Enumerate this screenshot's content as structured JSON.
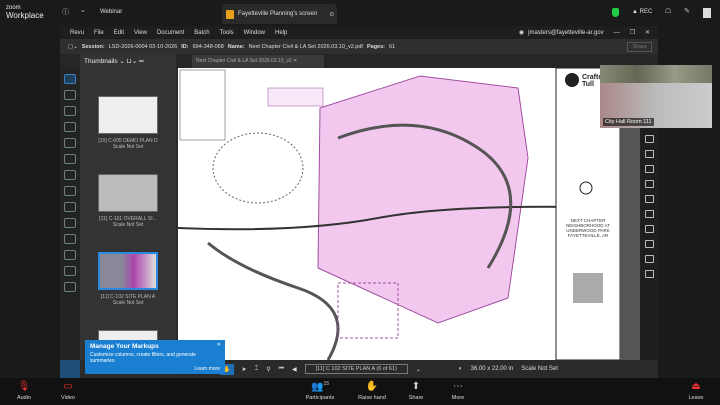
{
  "zoom": {
    "logo_top": "zoom",
    "logo_bottom": "Workplace",
    "webinar": "Webinar",
    "share_tab": "Fayetteville Planning's screen",
    "rec": "REC"
  },
  "bluebeam": {
    "menu": [
      "Revu",
      "File",
      "Edit",
      "View",
      "Document",
      "Batch",
      "Tools",
      "Window",
      "Help"
    ],
    "user": "jmasters@fayetteville-ar.gov",
    "session_label": "Session:",
    "session": "LSD-2026-0004 03-10-2026",
    "id_label": "ID:",
    "id": "694-348-068",
    "name_label": "Name:",
    "name": "Next Chapter Civil & LA Set 2026.03.10_v2.pdf",
    "pages_label": "Pages:",
    "pages": "61",
    "share": "Share",
    "panel_title": "Thumbnails",
    "doc_tab": "Next Chapter Civil & LA Set 2026.03.10_v2",
    "thumbnails": [
      {
        "label": "[10] C-005 DEMO PLAN D",
        "scale": "Scale Not Set"
      },
      {
        "label": "[11] C-101 OVERALL SI...",
        "scale": "Scale Not Set"
      },
      {
        "label": "[11] C-102 SITE PLAN A",
        "scale": "Scale Not Set"
      }
    ],
    "tip": {
      "title": "Manage Your Markups",
      "body": "Customize columns, create filters, and generate summaries",
      "link": "Learn more"
    },
    "page_nav": "[11] C 102 SITE PLAN A (6 of 61)",
    "size": "36.00 x 22.00 in",
    "scale": "Scale Not Set",
    "titleblock": {
      "firm": "Crafton Tull",
      "project": "NEXT CHAPTER NEIGHBORHOOD AT UNDERWOOD PARK",
      "city": "FAYETTEVILLE, AR"
    }
  },
  "video": {
    "name": "City Hall Room 111"
  },
  "controls": {
    "audio": "Audio",
    "video": "Video",
    "participants": "Participants",
    "participant_count": "15",
    "raise": "Raise hand",
    "share": "Share",
    "more": "More",
    "leave": "Leave"
  }
}
